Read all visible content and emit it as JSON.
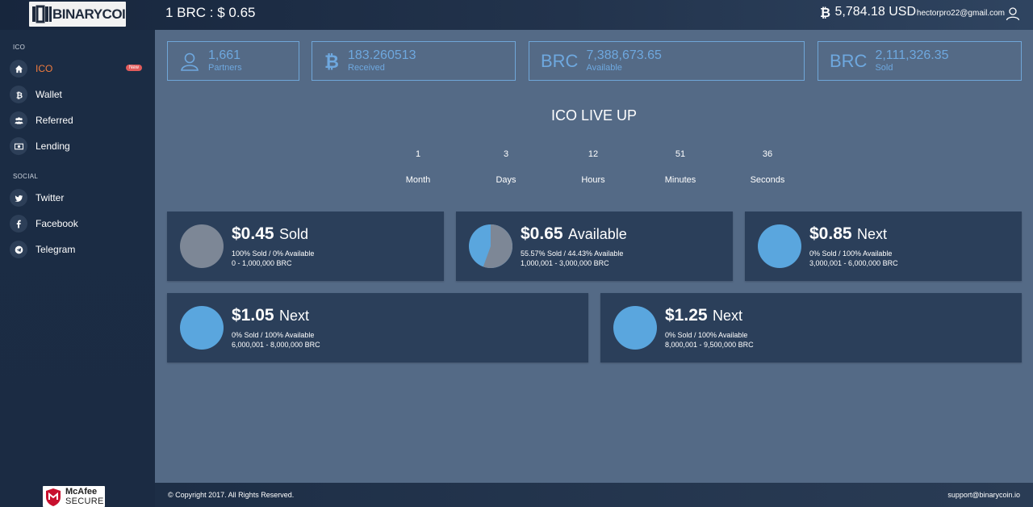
{
  "header": {
    "logo_text": "BINARYCOIN",
    "rate": "1 BRC : $ 0.65",
    "usd_balance": "5,784.18 USD",
    "email": "hectorpro22@gmail.com"
  },
  "sidebar": {
    "section_ico": "ICO",
    "section_social": "SOCIAL",
    "items": [
      {
        "label": "ICO",
        "icon": "home-icon",
        "badge": "New",
        "active": true
      },
      {
        "label": "Wallet",
        "icon": "bitcoin-icon"
      },
      {
        "label": "Referred",
        "icon": "users-icon"
      },
      {
        "label": "Lending",
        "icon": "money-icon"
      }
    ],
    "social": [
      {
        "label": "Twitter",
        "icon": "twitter-icon"
      },
      {
        "label": "Facebook",
        "icon": "facebook-icon"
      },
      {
        "label": "Telegram",
        "icon": "telegram-icon"
      }
    ],
    "mcafee": {
      "line1": "McAfee",
      "line2": "SECURE"
    }
  },
  "stats": [
    {
      "value": "1,661",
      "label": "Partners",
      "icon": "user-icon"
    },
    {
      "value": "183.260513",
      "label": "Received",
      "icon": "bitcoin-icon"
    },
    {
      "prefix": "BRC",
      "value": "7,388,673.65",
      "label": "Available"
    },
    {
      "prefix": "BRC",
      "value": "2,111,326.35",
      "label": "Sold"
    }
  ],
  "countdown": {
    "title": "ICO LIVE UP",
    "units": [
      {
        "value": "1",
        "label": "Month"
      },
      {
        "value": "3",
        "label": "Days"
      },
      {
        "value": "12",
        "label": "Hours"
      },
      {
        "value": "51",
        "label": "Minutes"
      },
      {
        "value": "36",
        "label": "Seconds"
      }
    ]
  },
  "colors": {
    "sold": "#7d8796",
    "available": "#5aa6de",
    "accent": "#f07b3e"
  },
  "cards": [
    {
      "price": "$0.45",
      "status": "Sold",
      "line1": "100% Sold / 0% Available",
      "line2": "0 - 1,000,000 BRC",
      "sold_fraction": 1.0
    },
    {
      "price": "$0.65",
      "status": "Available",
      "line1": "55.57% Sold / 44.43% Available",
      "line2": "1,000,001 - 3,000,000 BRC",
      "sold_fraction": 0.5557
    },
    {
      "price": "$0.85",
      "status": "Next",
      "line1": "0% Sold / 100% Available",
      "line2": "3,000,001 - 6,000,000 BRC",
      "sold_fraction": 0
    },
    {
      "price": "$1.05",
      "status": "Next",
      "line1": "0% Sold / 100% Available",
      "line2": "6,000,001 - 8,000,000 BRC",
      "sold_fraction": 0
    },
    {
      "price": "$1.25",
      "status": "Next",
      "line1": "0% Sold / 100% Available",
      "line2": "8,000,001 - 9,500,000 BRC",
      "sold_fraction": 0
    }
  ],
  "footer": {
    "copyright": "© Copyright 2017. All Rights Reserved.",
    "support": "support@binarycoin.io"
  }
}
